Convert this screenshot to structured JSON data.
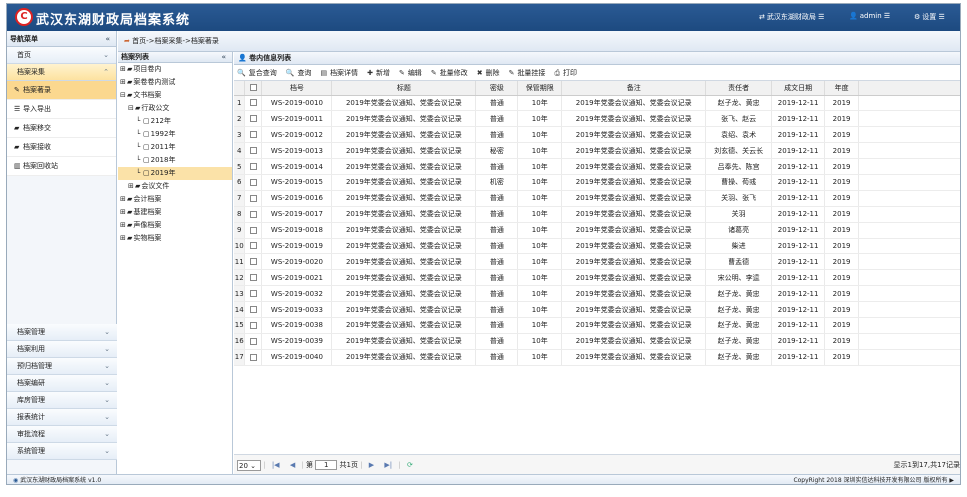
{
  "header": {
    "logo": "C",
    "title": "武汉东湖财政局档案系统",
    "org": "武汉东湖财政局",
    "user": "admin",
    "settings": "设置"
  },
  "nav": {
    "title": "导航菜单",
    "groups_top": [
      {
        "label": "首页"
      },
      {
        "label": "档案采集"
      }
    ],
    "items": [
      {
        "label": "档案著录",
        "icon": "edit-icon"
      },
      {
        "label": "导入导出",
        "icon": "list-icon"
      },
      {
        "label": "档案移交",
        "icon": "folder-icon"
      },
      {
        "label": "档案接收",
        "icon": "folder-icon"
      },
      {
        "label": "档案回收站",
        "icon": "trash-icon"
      }
    ],
    "groups_bottom": [
      {
        "label": "档案管理"
      },
      {
        "label": "档案利用"
      },
      {
        "label": "预归档管理"
      },
      {
        "label": "档案编研"
      },
      {
        "label": "库房管理"
      },
      {
        "label": "报表统计"
      },
      {
        "label": "审批流程"
      },
      {
        "label": "系统管理"
      }
    ]
  },
  "breadcrumb": "首页->档案采集->档案著录",
  "tree": {
    "title": "档案列表",
    "nodes": [
      {
        "label": "项目卷内",
        "toggle": "⊞",
        "level": 0
      },
      {
        "label": "案卷卷内测试",
        "toggle": "⊞",
        "level": 0
      },
      {
        "label": "文书档案",
        "toggle": "⊟",
        "level": 0
      },
      {
        "label": "行政公文",
        "toggle": "⊟",
        "level": 1
      },
      {
        "label": "212年",
        "toggle": "",
        "level": 2
      },
      {
        "label": "1992年",
        "toggle": "",
        "level": 2
      },
      {
        "label": "2011年",
        "toggle": "",
        "level": 2
      },
      {
        "label": "2018年",
        "toggle": "",
        "level": 2
      },
      {
        "label": "2019年",
        "toggle": "",
        "level": 2
      },
      {
        "label": "会议文件",
        "toggle": "⊞",
        "level": 1
      },
      {
        "label": "会计档案",
        "toggle": "⊞",
        "level": 0
      },
      {
        "label": "基建档案",
        "toggle": "⊞",
        "level": 0
      },
      {
        "label": "声像档案",
        "toggle": "⊞",
        "level": 0
      },
      {
        "label": "实物档案",
        "toggle": "⊞",
        "level": 0
      }
    ]
  },
  "main": {
    "title": "卷内信息列表",
    "toolbar": [
      {
        "label": "复合查询",
        "icon": "search-icon",
        "glyph": "🔍"
      },
      {
        "label": "查询",
        "icon": "search-icon",
        "glyph": "🔍"
      },
      {
        "label": "档案详情",
        "icon": "document-icon",
        "glyph": "▤"
      },
      {
        "label": "新增",
        "icon": "plus-icon",
        "glyph": "✚"
      },
      {
        "label": "编辑",
        "icon": "edit-icon",
        "glyph": "✎"
      },
      {
        "label": "批量修改",
        "icon": "edit-icon",
        "glyph": "✎"
      },
      {
        "label": "删除",
        "icon": "delete-icon",
        "glyph": "✖"
      },
      {
        "label": "批量挂接",
        "icon": "edit-icon",
        "glyph": "✎"
      },
      {
        "label": "打印",
        "icon": "print-icon",
        "glyph": "⎙"
      }
    ],
    "columns": [
      "档号",
      "标题",
      "密级",
      "保管期限",
      "备注",
      "责任者",
      "成文日期",
      "年度"
    ],
    "rows": [
      [
        "1",
        "WS-2019-0010",
        "2019年党委会议通知、党委会议记录",
        "普通",
        "10年",
        "2019年党委会议通知、党委会议记录",
        "赵子龙、黄忠",
        "2019-12-11",
        "2019"
      ],
      [
        "2",
        "WS-2019-0011",
        "2019年党委会议通知、党委会议记录",
        "普通",
        "10年",
        "2019年党委会议通知、党委会议记录",
        "张飞、赵云",
        "2019-12-11",
        "2019"
      ],
      [
        "3",
        "WS-2019-0012",
        "2019年党委会议通知、党委会议记录",
        "普通",
        "10年",
        "2019年党委会议通知、党委会议记录",
        "袁绍、袁术",
        "2019-12-11",
        "2019"
      ],
      [
        "4",
        "WS-2019-0013",
        "2019年党委会议通知、党委会议记录",
        "秘密",
        "10年",
        "2019年党委会议通知、党委会议记录",
        "刘玄德、关云长",
        "2019-12-11",
        "2019"
      ],
      [
        "5",
        "WS-2019-0014",
        "2019年党委会议通知、党委会议记录",
        "普通",
        "10年",
        "2019年党委会议通知、党委会议记录",
        "吕奉先、陈宫",
        "2019-12-11",
        "2019"
      ],
      [
        "6",
        "WS-2019-0015",
        "2019年党委会议通知、党委会议记录",
        "机密",
        "10年",
        "2019年党委会议通知、党委会议记录",
        "曹操、荀彧",
        "2019-12-11",
        "2019"
      ],
      [
        "7",
        "WS-2019-0016",
        "2019年党委会议通知、党委会议记录",
        "普通",
        "10年",
        "2019年党委会议通知、党委会议记录",
        "关羽、张飞",
        "2019-12-11",
        "2019"
      ],
      [
        "8",
        "WS-2019-0017",
        "2019年党委会议通知、党委会议记录",
        "普通",
        "10年",
        "2019年党委会议通知、党委会议记录",
        "关羽",
        "2019-12-11",
        "2019"
      ],
      [
        "9",
        "WS-2019-0018",
        "2019年党委会议通知、党委会议记录",
        "普通",
        "10年",
        "2019年党委会议通知、党委会议记录",
        "诸葛亮",
        "2019-12-11",
        "2019"
      ],
      [
        "10",
        "WS-2019-0019",
        "2019年党委会议通知、党委会议记录",
        "普通",
        "10年",
        "2019年党委会议通知、党委会议记录",
        "柴进",
        "2019-12-11",
        "2019"
      ],
      [
        "11",
        "WS-2019-0020",
        "2019年党委会议通知、党委会议记录",
        "普通",
        "10年",
        "2019年党委会议通知、党委会议记录",
        "曹孟德",
        "2019-12-11",
        "2019"
      ],
      [
        "12",
        "WS-2019-0021",
        "2019年党委会议通知、党委会议记录",
        "普通",
        "10年",
        "2019年党委会议通知、党委会议记录",
        "宋公明、李逵",
        "2019-12-11",
        "2019"
      ],
      [
        "13",
        "WS-2019-0032",
        "2019年党委会议通知、党委会议记录",
        "普通",
        "10年",
        "2019年党委会议通知、党委会议记录",
        "赵子龙、黄忠",
        "2019-12-11",
        "2019"
      ],
      [
        "14",
        "WS-2019-0033",
        "2019年党委会议通知、党委会议记录",
        "普通",
        "10年",
        "2019年党委会议通知、党委会议记录",
        "赵子龙、黄忠",
        "2019-12-11",
        "2019"
      ],
      [
        "15",
        "WS-2019-0038",
        "2019年党委会议通知、党委会议记录",
        "普通",
        "10年",
        "2019年党委会议通知、党委会议记录",
        "赵子龙、黄忠",
        "2019-12-11",
        "2019"
      ],
      [
        "16",
        "WS-2019-0039",
        "2019年党委会议通知、党委会议记录",
        "普通",
        "10年",
        "2019年党委会议通知、党委会议记录",
        "赵子龙、黄忠",
        "2019-12-11",
        "2019"
      ],
      [
        "17",
        "WS-2019-0040",
        "2019年党委会议通知、党委会议记录",
        "普通",
        "10年",
        "2019年党委会议通知、党委会议记录",
        "赵子龙、黄忠",
        "2019-12-11",
        "2019"
      ]
    ]
  },
  "pager": {
    "page_size": "20",
    "page_prefix": "第",
    "page": "1",
    "page_suffix": "共1页",
    "summary": "显示1到17,共17记录"
  },
  "footer": {
    "left": "武汉东湖财政局档案系统 v1.0",
    "right": "CopyRight 2018  深圳实信达科技开发有限公司 版权所有"
  },
  "colors": {
    "header": "#1d4a80",
    "active": "#fbd88f"
  }
}
